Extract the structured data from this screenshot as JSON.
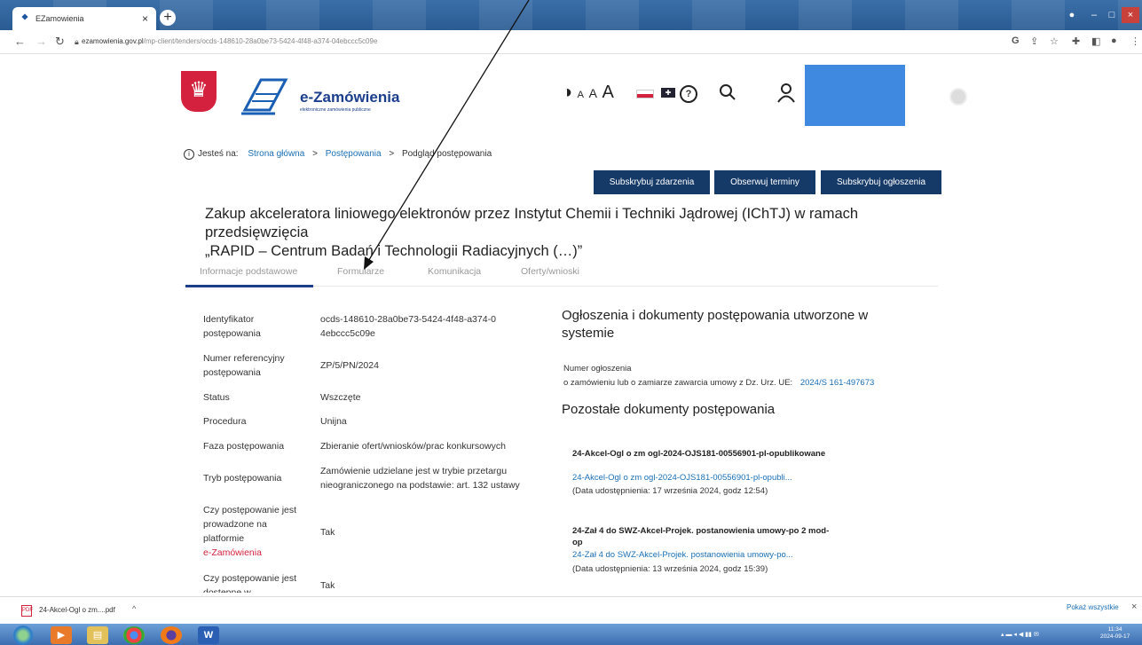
{
  "browser": {
    "tab_title": "EZamowienia",
    "tab_close": "×",
    "new_tab": "+",
    "url_host": "ezamowienia.gov.pl",
    "url_path": "/mp-client/tenders/ocds-148610-28a0be73-5424-4f48-a374-04ebccc5c09e"
  },
  "header": {
    "logo_title": "e-Zamówienia",
    "logo_subtitle": "elektroniczne zamówienia publiczne",
    "a11y_contrast": "◑",
    "a11y_font_small": "A",
    "a11y_font_mid": "A",
    "a11y_font_large": "A",
    "help": "?"
  },
  "breadcrumb": {
    "prefix": "Jesteś na:",
    "items": [
      "Strona główna",
      "Postępowania",
      "Podgląd postępowania"
    ],
    "separator": ">"
  },
  "actions": {
    "subscribe_events": "Subskrybuj zdarzenia",
    "watch_deadlines": "Obserwuj terminy",
    "subscribe_notices": "Subskrybuj ogłoszenia"
  },
  "title": {
    "line1": "Zakup akceleratora liniowego elektronów przez Instytut Chemii i Techniki Jądrowej (IChTJ) w ramach przedsięwzięcia",
    "line2": "„RAPID – Centrum Badań i Technologii Radiacyjnych (…)”"
  },
  "tabs": [
    "Informacje podstawowe",
    "Formularze",
    "Komunikacja",
    "Oferty/wnioski"
  ],
  "info": {
    "id_label": "Identyfikator postępowania",
    "id_value": "ocds-148610-28a0be73-5424-4f48-a374-04ebccc5c09e",
    "ref_label": "Numer referencyjny postępowania",
    "ref_value": "ZP/5/PN/2024",
    "status_label": "Status",
    "status_value": "Wszczęte",
    "procedure_label": "Procedura",
    "procedure_value": "Unijna",
    "phase_label": "Faza postępowania",
    "phase_value": "Zbieranie ofert/wniosków/prac konkursowych",
    "mode_label": "Tryb postępowania",
    "mode_value": "Zamówienie udzielane jest w trybie przetargu nieograniczonego na podstawie: art. 132 ustawy",
    "platform_label": "Czy postępowanie jest prowadzone na platformie",
    "platform_label_red": "e-Zamówienia",
    "platform_value": "Tak",
    "available_label": "Czy postępowanie jest dostępne w",
    "available_value": "Tak"
  },
  "right": {
    "notices_heading": "Ogłoszenia i dokumenty postępowania utworzone w systemie",
    "notice_number_label": "Numer ogłoszenia",
    "notice_desc": "o zamówieniu lub o zamiarze zawarcia umowy z Dz. Urz. UE:",
    "notice_link": "2024/S 161-497673",
    "other_heading": "Pozostałe dokumenty postępowania",
    "docs": [
      {
        "title": "24-Akcel-Ogl o zm ogl-2024-OJS181-00556901-pl-opublikowane",
        "link": "24-Akcel-Ogl o zm ogl-2024-OJS181-00556901-pl-opubli...",
        "date": "(Data udostępnienia: 17 września 2024, godz 12:54)"
      },
      {
        "title": "24-Zał 4 do SWZ-Akcel-Projek. postanowienia umowy-po 2 mod-op",
        "link": "24-Zał 4 do SWZ-Akcel-Projek. postanowienia umowy-po...",
        "date": "(Data udostępnienia: 13 września 2024, godz 15:39)"
      }
    ]
  },
  "downloads": {
    "file": "24-Akcel-Ogl o zm....pdf",
    "chevron": "^",
    "show_all": "Pokaż wszystkie",
    "close": "×"
  },
  "taskbar": {
    "clock_time": "11:34",
    "clock_date": "2024-09-17"
  },
  "colors": {
    "brand_navy": "#163a68",
    "link_blue": "#1a6fb5",
    "accent_red": "#d4213d"
  }
}
